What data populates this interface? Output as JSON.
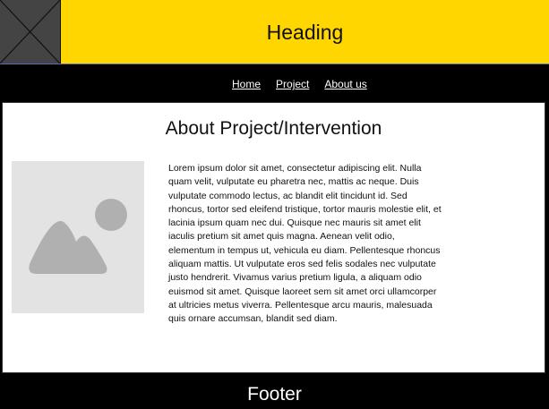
{
  "header": {
    "heading": "Heading",
    "logo_icon": "broken-image-x-icon"
  },
  "nav": {
    "items": [
      {
        "label": "Home"
      },
      {
        "label": "Project"
      },
      {
        "label": "About us"
      }
    ]
  },
  "main": {
    "title": "About Project/Intervention",
    "image_icon": "image-placeholder-icon",
    "body": "Lorem ipsum dolor sit amet, consectetur adipiscing elit. Nulla quam velit, vulputate eu pharetra nec, mattis ac neque. Duis vulputate commodo lectus, ac blandit elit tincidunt id. Sed rhoncus, tortor sed eleifend tristique, tortor mauris molestie elit, et lacinia ipsum quam nec dui. Quisque nec mauris sit amet elit iaculis pretium sit amet quis magna. Aenean velit odio, elementum in tempus ut, vehicula eu diam. Pellentesque rhoncus aliquam mattis. Ut vulputate eros sed felis sodales nec vulputate justo hendrerit. Vivamus varius pretium ligula, a aliquam odio euismod sit amet. Quisque laoreet sem sit amet orci ullamcorper at ultricies metus viverra. Pellentesque arcu mauris, malesuada quis ornare accumsan, blandit sed diam."
  },
  "footer": {
    "text": "Footer"
  },
  "colors": {
    "header_bg": "#ffd600",
    "nav_bg": "#000000",
    "footer_bg": "#000000",
    "placeholder_bg": "#e3e3e3",
    "placeholder_shape": "#b0b0b0"
  }
}
